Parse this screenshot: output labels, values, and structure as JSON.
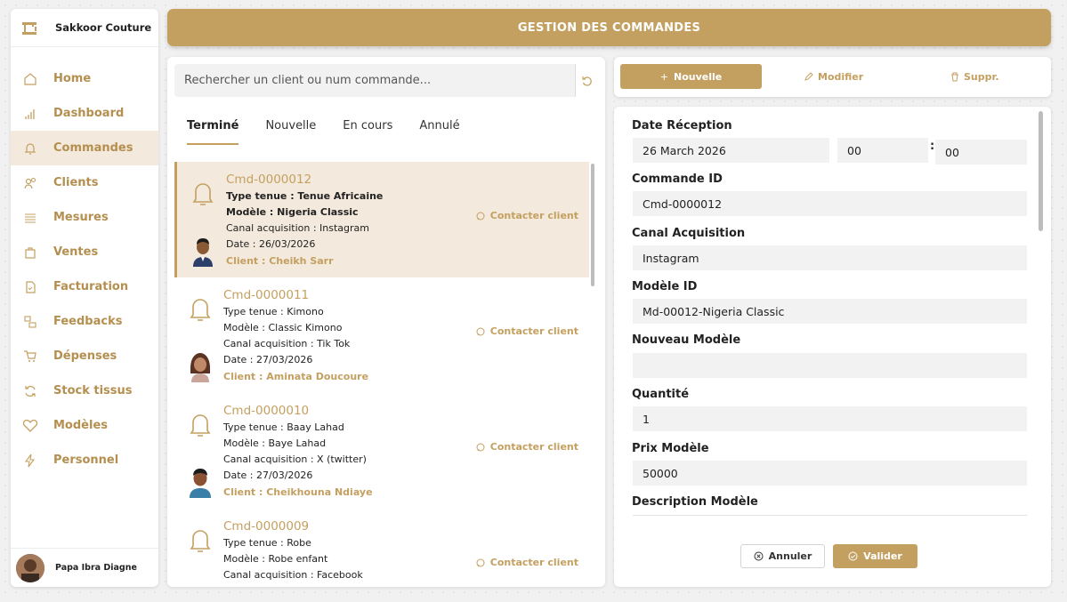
{
  "app": {
    "brand": "Sakkoor Couture",
    "header_title": "GESTION DES COMMANDES"
  },
  "sidebar": {
    "items": [
      {
        "label": "Home",
        "icon": "home-icon"
      },
      {
        "label": "Dashboard",
        "icon": "bar-chart-icon"
      },
      {
        "label": "Commandes",
        "icon": "bell-icon",
        "active": true
      },
      {
        "label": "Clients",
        "icon": "users-icon"
      },
      {
        "label": "Mesures",
        "icon": "list-icon"
      },
      {
        "label": "Ventes",
        "icon": "bag-icon"
      },
      {
        "label": "Facturation",
        "icon": "invoice-icon"
      },
      {
        "label": "Feedbacks",
        "icon": "feedback-icon"
      },
      {
        "label": "Dépenses",
        "icon": "cart-icon"
      },
      {
        "label": "Stock tissus",
        "icon": "refresh-icon"
      },
      {
        "label": "Modèles",
        "icon": "heart-icon"
      },
      {
        "label": "Personnel",
        "icon": "bolt-icon"
      }
    ],
    "user_name": "Papa Ibra Diagne"
  },
  "search": {
    "placeholder": "Rechercher un client ou num commande..."
  },
  "tabs": [
    "Terminé",
    "Nouvelle",
    "En cours",
    "Annulé"
  ],
  "orders": [
    {
      "id": "Cmd-0000012",
      "type": "Type tenue : Tenue Africaine",
      "model": "Modèle : Nigeria Classic",
      "channel": "Canal acquisition : Instagram",
      "date": "Date : 26/03/2026",
      "client": "Client : Cheikh Sarr",
      "contact": "Contacter client"
    },
    {
      "id": "Cmd-0000011",
      "type": "Type tenue : Kimono",
      "model": "Modèle : Classic Kimono",
      "channel": "Canal acquisition : Tik Tok",
      "date": "Date : 27/03/2026",
      "client": "Client : Aminata Doucoure",
      "contact": "Contacter client"
    },
    {
      "id": "Cmd-0000010",
      "type": "Type tenue : Baay Lahad",
      "model": "Modèle : Baye Lahad",
      "channel": "Canal acquisition : X (twitter)",
      "date": "Date : 27/03/2026",
      "client": "Client : Cheikhouna Ndiaye",
      "contact": "Contacter client"
    },
    {
      "id": "Cmd-0000009",
      "type": "Type tenue : Robe",
      "model": "Modèle : Robe enfant",
      "channel": "Canal acquisition : Facebook",
      "date": "",
      "client": "",
      "contact": "Contacter client"
    }
  ],
  "actions": {
    "new": "Nouvelle",
    "edit": "Modifier",
    "delete": "Suppr."
  },
  "form": {
    "date_label": "Date Réception",
    "date_value": "26 March 2026",
    "hour": "00",
    "minute": "00",
    "time_sep": ":",
    "order_id_label": "Commande ID",
    "order_id_value": "Cmd-0000012",
    "channel_label": "Canal Acquisition",
    "channel_value": "Instagram",
    "model_id_label": "Modèle ID",
    "model_id_value": "Md-00012-Nigeria Classic",
    "new_model_label": "Nouveau Modèle",
    "new_model_value": "",
    "quantity_label": "Quantité",
    "quantity_value": "1",
    "price_label": "Prix Modèle",
    "price_value": "50000",
    "description_label": "Description Modèle",
    "cancel": "Annuler",
    "validate": "Valider"
  },
  "colors": {
    "accent": "#c4a060",
    "active_bg": "#f3e9dc",
    "field_bg": "#f2f2f2"
  }
}
